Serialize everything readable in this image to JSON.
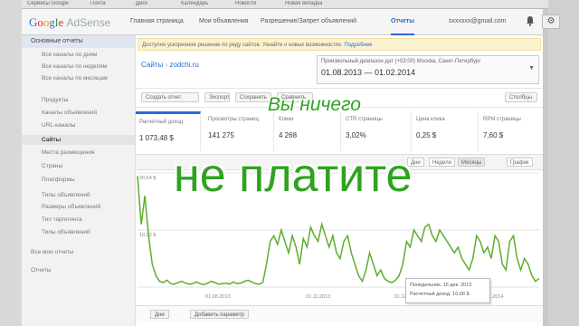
{
  "browser": {
    "tabs": [
      "Сервисы Google",
      "Почта",
      "Диск",
      "Календарь",
      "Новости",
      "Новая вкладка"
    ]
  },
  "header": {
    "logo_google": [
      "G",
      "o",
      "o",
      "g",
      "l",
      "e"
    ],
    "logo_product": "AdSense",
    "nav": [
      {
        "label": "Главная страница",
        "active": false
      },
      {
        "label": "Мои объявления",
        "active": false
      },
      {
        "label": "Разрешение/Запрет объявлений",
        "active": false
      },
      {
        "label": "Отчеты",
        "active": true
      }
    ],
    "email": "sxxxxxx@gmail.com"
  },
  "sidebar": {
    "heading": "Основные отчеты",
    "items": [
      {
        "label": "Все каналы по дням",
        "active": false
      },
      {
        "label": "Все каналы по неделям",
        "active": false
      },
      {
        "label": "Все каналы по месяцам",
        "active": false
      },
      {
        "label": "Продукты",
        "active": false
      },
      {
        "label": "Каналы объявлений",
        "active": false
      },
      {
        "label": "URL-каналы",
        "active": false
      },
      {
        "label": "Сайты",
        "active": true
      },
      {
        "label": "Места размещения",
        "active": false
      },
      {
        "label": "Страны",
        "active": false
      },
      {
        "label": "Платформы",
        "active": false
      },
      {
        "label": "Типы объявлений",
        "active": false
      },
      {
        "label": "Размеры объявлений",
        "active": false
      },
      {
        "label": "Тип таргетинга",
        "active": false
      },
      {
        "label": "Типы объявлений",
        "active": false
      }
    ],
    "footer_items": [
      "Все мои отчеты",
      "Отчеты"
    ]
  },
  "main": {
    "notice_text": "Доступно ускоренное решение по ряду сайтов. Узнайте о новых возможностях.",
    "notice_link": "Подробнее",
    "breadcrumb": [
      "Сайты",
      "zodchi.ru"
    ],
    "date_label": "Произвольный диапазон дат (+03:00) Москва, Санкт-Петербург",
    "date_value": "01.08.2013 — 01.02.2014",
    "toolbar": [
      "Создать отчет",
      "Экспорт",
      "Сохранить",
      "Сравнить",
      "Столбцы"
    ],
    "metrics": [
      {
        "label": "Расчетный доход",
        "value": "1 073,48 $"
      },
      {
        "label": "Просмотры страниц",
        "value": "141 275"
      },
      {
        "label": "Клики",
        "value": "4 268"
      },
      {
        "label": "CTR страницы",
        "value": "3,02%"
      },
      {
        "label": "Цена клика",
        "value": "0,25 $"
      },
      {
        "label": "RPM страницы",
        "value": "7,60 $"
      }
    ],
    "chart_tabs": [
      "Дни",
      "Недели",
      "Месяцы",
      "График"
    ],
    "tooltip": {
      "date": "Понедельник, 16 дек. 2013",
      "value": "Расчетный доход: 10,68 $"
    },
    "bottom": [
      "Дни",
      "Добавить параметр"
    ]
  },
  "chart_data": {
    "type": "line",
    "series": [
      {
        "values": [
          19.5,
          11,
          16,
          9,
          4,
          2,
          1,
          0.8,
          1.2,
          0.6,
          0.5,
          0.8,
          1,
          0.7,
          0.5,
          0.6,
          0.9,
          0.6,
          0.4,
          0.7,
          1,
          0.8,
          0.5,
          0.6,
          0.7,
          0.5,
          0.9,
          0.6,
          0.7,
          1,
          1.2,
          0.9,
          0.6,
          0.5,
          0.8,
          4,
          8,
          9,
          7.5,
          10,
          8,
          6,
          9,
          7,
          4,
          8.5,
          7,
          10.5,
          9,
          8,
          11,
          9,
          7,
          9,
          6,
          5,
          8,
          9,
          6,
          4,
          2,
          1,
          3,
          6,
          4,
          2,
          3,
          1.5,
          1,
          0.8,
          1.2,
          2,
          4,
          8,
          7,
          10,
          9,
          8,
          10.5,
          11,
          9,
          8,
          10,
          9,
          8,
          7,
          6,
          7,
          5,
          4,
          3,
          5,
          9,
          8,
          6,
          7,
          5,
          9,
          8,
          4,
          3,
          8,
          9,
          5,
          3,
          5,
          4,
          2,
          1,
          1.5
        ]
      }
    ],
    "ylim": [
      0,
      20
    ],
    "ytick_labels": [
      "20,64 $",
      "10,32 $"
    ],
    "xtick_labels": [
      "01.08.2013",
      "01.11.2013",
      "01.12.2013",
      "01.01.2014"
    ],
    "color": "#5dae2f"
  },
  "overlay": {
    "line1": "Вы ничего",
    "line2": "не платите"
  }
}
